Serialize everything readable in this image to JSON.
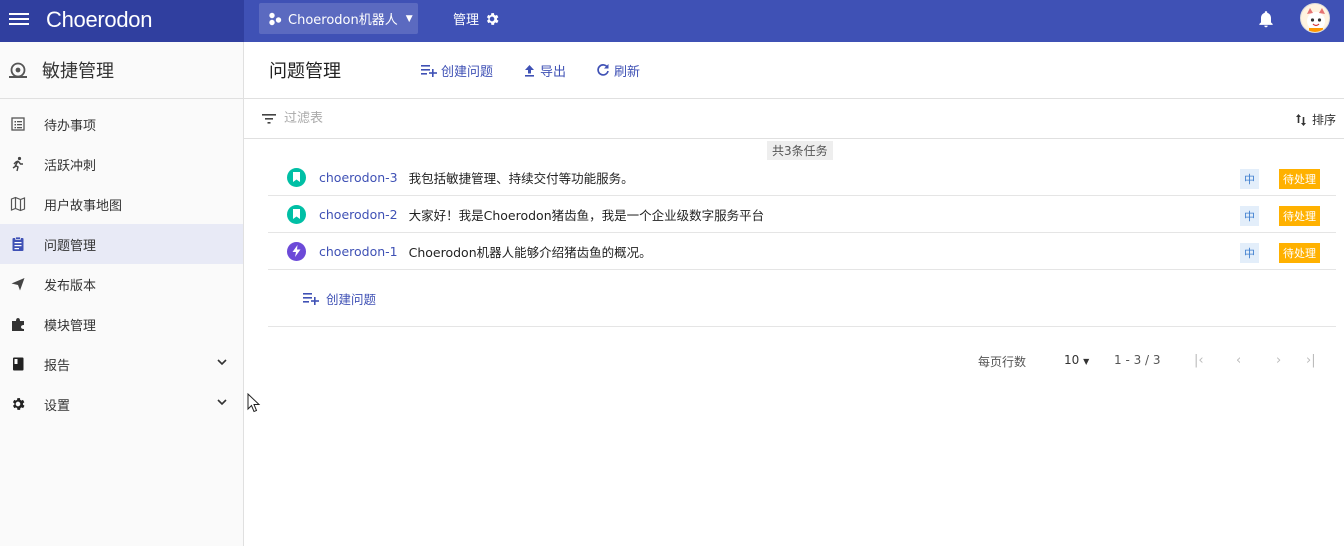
{
  "topbar": {
    "brand": "Choerodon",
    "project": "Choerodon机器人",
    "manage": "管理"
  },
  "sidebar": {
    "title": "敏捷管理",
    "items": [
      {
        "label": "待办事项"
      },
      {
        "label": "活跃冲刺"
      },
      {
        "label": "用户故事地图"
      },
      {
        "label": "问题管理"
      },
      {
        "label": "发布版本"
      },
      {
        "label": "模块管理"
      },
      {
        "label": "报告"
      },
      {
        "label": "设置"
      }
    ]
  },
  "main": {
    "title": "问题管理",
    "tools": {
      "create": "创建问题",
      "export": "导出",
      "refresh": "刷新"
    },
    "filter_placeholder": "过滤表",
    "sort_label": "排序",
    "count_text": "共3条任务",
    "issues": [
      {
        "key": "choerodon-3",
        "summary": "我包括敏捷管理、持续交付等功能服务。",
        "priority": "中",
        "status": "待处理",
        "type_color": "#00bfa5",
        "type_icon": "story-icon"
      },
      {
        "key": "choerodon-2",
        "summary": "大家好！我是Choerodon猪齿鱼，我是一个企业级数字服务平台",
        "priority": "中",
        "status": "待处理",
        "type_color": "#00bfa5",
        "type_icon": "story-icon"
      },
      {
        "key": "choerodon-1",
        "summary": "Choerodon机器人能够介绍猪齿鱼的概况。",
        "priority": "中",
        "status": "待处理",
        "type_color": "#6c4ad8",
        "type_icon": "epic-icon"
      }
    ],
    "create_issue": "创建问题"
  },
  "pager": {
    "rows_label": "每页行数",
    "page_size": "10",
    "range": "1 - 3 / 3"
  },
  "colors": {
    "primary": "#3f51b5",
    "primary_dark": "#303f9f",
    "status": "#ffb100"
  }
}
